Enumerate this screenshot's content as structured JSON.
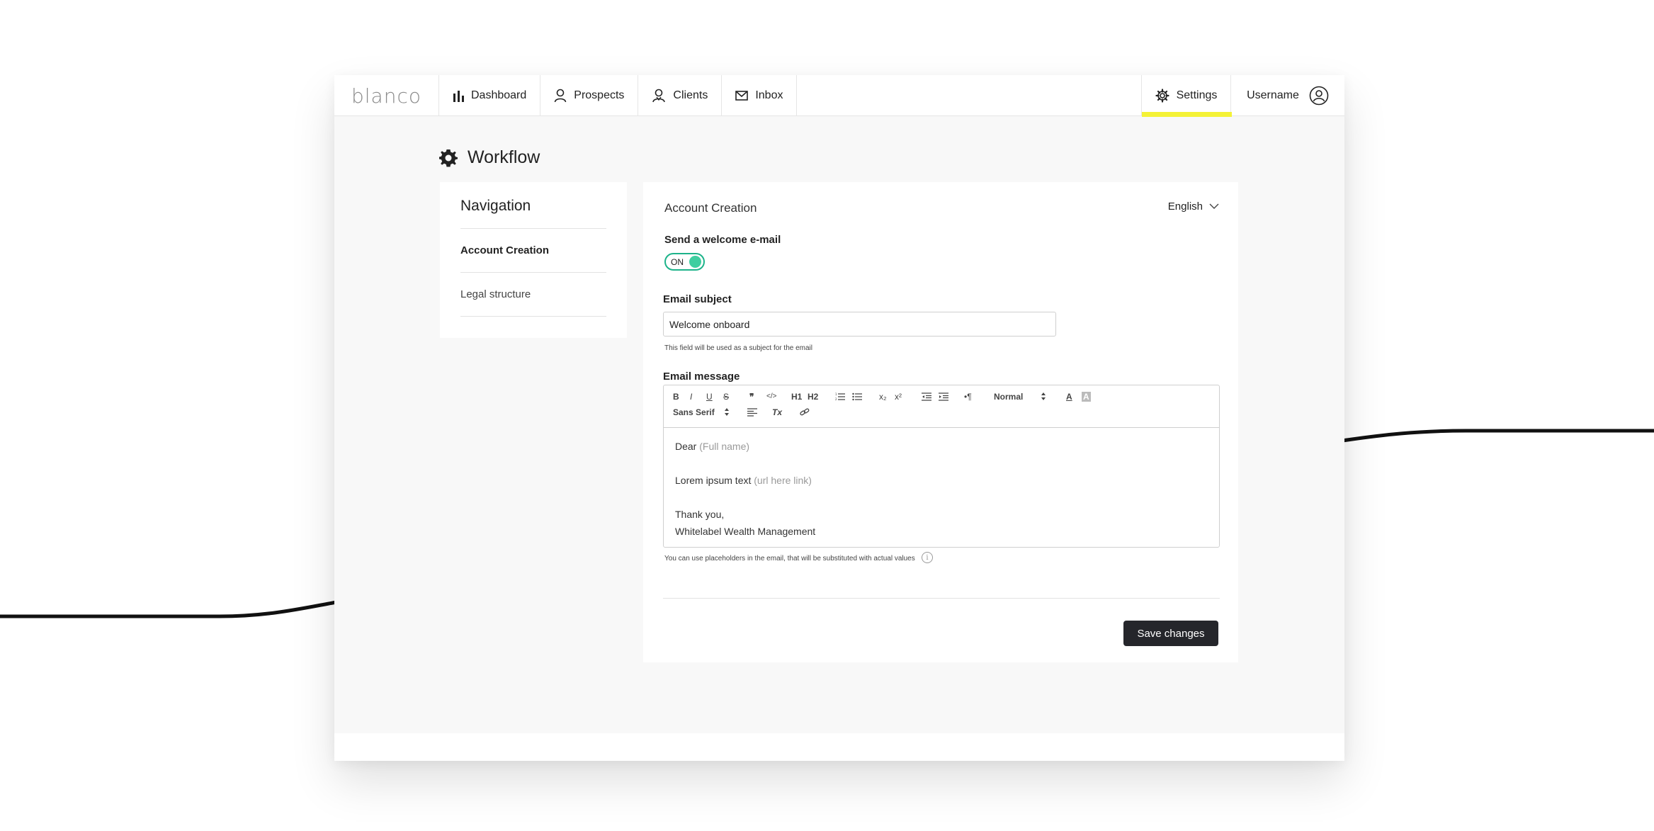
{
  "app": {
    "logo": "blanco"
  },
  "topnav": {
    "items": [
      {
        "label": "Dashboard",
        "icon": "bar-chart-icon"
      },
      {
        "label": "Prospects",
        "icon": "person-icon"
      },
      {
        "label": "Clients",
        "icon": "clients-icon"
      },
      {
        "label": "Inbox",
        "icon": "envelope-icon"
      }
    ],
    "settings_label": "Settings",
    "username": "Username",
    "accent_color": "#f4f236"
  },
  "page": {
    "title": "Workflow"
  },
  "sidenav": {
    "heading": "Navigation",
    "items": [
      {
        "label": "Account Creation",
        "active": true
      },
      {
        "label": "Legal structure",
        "active": false
      }
    ]
  },
  "main": {
    "title": "Account Creation",
    "language": "English",
    "welcome": {
      "label": "Send a welcome e-mail",
      "toggle": "ON",
      "toggle_color": "#3fcea0"
    },
    "subject": {
      "label": "Email subject",
      "value": "Welcome onboard",
      "hint": "This field will be used as a subject for the email"
    },
    "message": {
      "label": "Email message",
      "toolbar": {
        "bold": "B",
        "italic": "I",
        "underline": "U",
        "strike": "S",
        "quote": "❞",
        "code": "</>",
        "h1": "H1",
        "h2": "H2",
        "ordered_list": "ordered-list-icon",
        "bullet_list": "bullet-list-icon",
        "subscript": "x₂",
        "superscript": "x²",
        "outdent": "outdent-icon",
        "indent": "indent-icon",
        "rtl": "•¶",
        "size": "Normal",
        "font": "Sans Serif",
        "text_color": "A",
        "background_color": "A",
        "align": "align-icon",
        "clean": "Tx",
        "link": "link-icon"
      },
      "body": {
        "line1": "Dear",
        "line1_placeholder": "(Full name)",
        "line2": "Lorem ipsum text",
        "line2_placeholder": "(url here link)",
        "line3": "Thank you,",
        "line4": "Whitelabel Wealth Management"
      },
      "hint": "You can use placeholders in the email, that will be substituted with actual values",
      "info": "i"
    },
    "save_label": "Save changes"
  }
}
